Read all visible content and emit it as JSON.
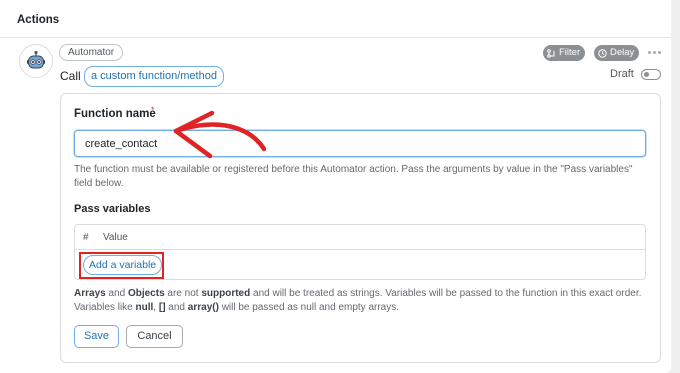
{
  "panel": {
    "title": "Actions"
  },
  "action": {
    "integration": "Automator",
    "call_label": "Call",
    "token": "a custom function/method",
    "filter_label": "Filter",
    "delay_label": "Delay",
    "status_label": "Draft"
  },
  "form": {
    "function_name_label": "Function name",
    "required_mark": "*",
    "function_name_value": "create_contact",
    "function_help": "The function must be available or registered before this Automator action. Pass the arguments by value in the \"Pass variables\" field below.",
    "pass_variables_label": "Pass variables",
    "table_header": {
      "number": "#",
      "value": "Value"
    },
    "add_variable_label": "Add a variable",
    "notes": {
      "part1": "Arrays",
      "part2": " and ",
      "part3": "Objects",
      "part4": " are not ",
      "part5": "supported",
      "part6": " and will be treated as strings. Variables will be passed to the function in this exact order. Variables like ",
      "part7": "null",
      "part8": ", ",
      "part9": "[]",
      "part10": " and ",
      "part11": "array()",
      "part12": " will be passed as null and empty arrays."
    },
    "save_label": "Save",
    "cancel_label": "Cancel"
  },
  "colors": {
    "accent": "#2271b1",
    "annotation": "#e02424"
  },
  "icons": [
    "robot-icon",
    "filter-icon",
    "clock-icon",
    "more-icon",
    "arrow-annotation"
  ]
}
